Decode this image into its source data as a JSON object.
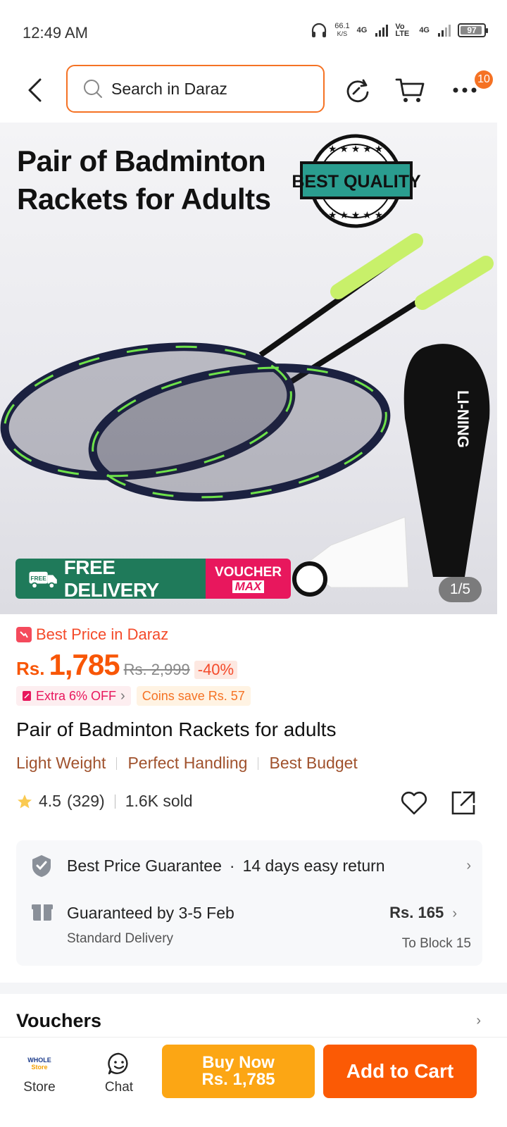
{
  "status_bar": {
    "time": "12:49 AM",
    "net_speed_value": "66.1",
    "net_speed_unit": "K/S",
    "network1": "4G",
    "network_volte": "Vo LTE",
    "network2": "4G",
    "battery": "97"
  },
  "top_nav": {
    "search_placeholder": "Search in Daraz",
    "cart_badge": "10"
  },
  "hero": {
    "title_line1": "Pair of Badminton",
    "title_line2": "Rackets for Adults",
    "seal_text": "BEST QUALITY",
    "brand_on_case": "LI-NING",
    "promo_free_tag": "FREE",
    "promo_free": "FREE DELIVERY",
    "promo_voucher": "VOUCHER",
    "promo_voucher_max": "MAX",
    "page_indicator": "1/5"
  },
  "price": {
    "best_price_label": "Best Price in Daraz",
    "currency": "Rs.",
    "current": "1,785",
    "original": "Rs. 2,999",
    "discount": "-40%",
    "extra_off": "Extra 6% OFF",
    "coins_save": "Coins save Rs. 57"
  },
  "product": {
    "title": "Pair of Badminton Rackets for adults",
    "features": [
      "Light Weight",
      "Perfect Handling",
      "Best Budget"
    ],
    "rating": "4.5",
    "review_count": "(329)",
    "sold": "1.6K sold"
  },
  "service": {
    "guarantee": "Best Price Guarantee",
    "separator": "·",
    "returns": "14 days easy return",
    "delivery_main": "Guaranteed by 3-5 Feb",
    "delivery_type": "Standard Delivery",
    "delivery_fee": "Rs. 165",
    "destination": "To Block 15"
  },
  "vouchers": {
    "title": "Vouchers"
  },
  "bottom_bar": {
    "store_logo_line1": "WHOLE",
    "store_logo_line2": "Store",
    "store_label": "Store",
    "chat_label": "Chat",
    "buy_now_line1": "Buy Now",
    "buy_now_line2": "Rs. 1,785",
    "add_to_cart": "Add to Cart"
  },
  "colors": {
    "accent": "#f57224",
    "price": "#f85606",
    "buy_now": "#fca614",
    "add_to_cart": "#fb5a05"
  }
}
